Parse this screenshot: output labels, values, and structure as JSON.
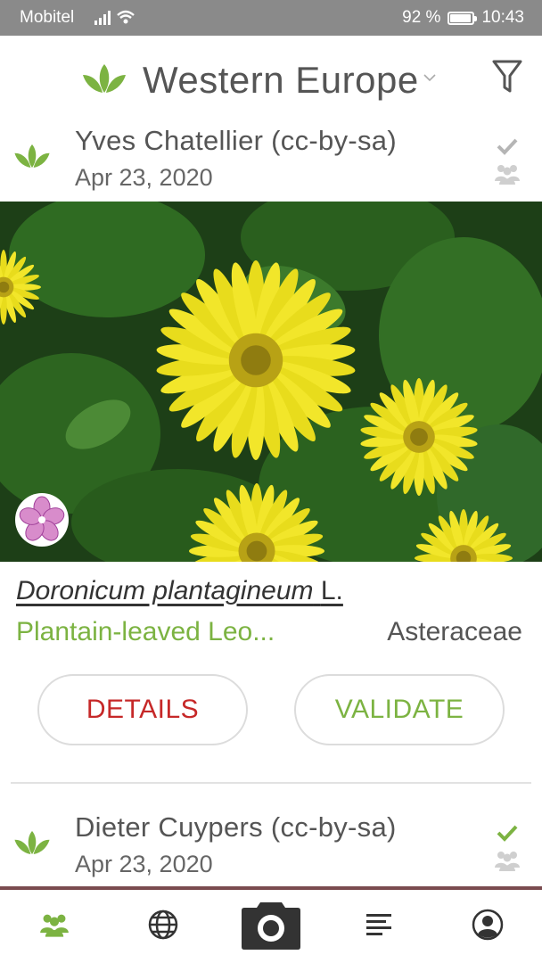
{
  "status_bar": {
    "carrier": "Mobitel",
    "battery": "92 %",
    "battery_level": 0.92,
    "time": "10:43"
  },
  "header": {
    "region": "Western Europe",
    "icons": [
      "leaf-logo-icon",
      "chevron-down-icon",
      "filter-icon"
    ]
  },
  "observations": [
    {
      "author": "Yves Chatellier (cc-by-sa)",
      "date": "Apr 23, 2020",
      "validated": false,
      "photo_subject": "yellow daisy flowers",
      "species": {
        "scientific": "Doronicum plantagineum",
        "authority": "L.",
        "common": "Plantain-leaved Leo...",
        "family": "Asteraceae"
      },
      "actions": {
        "details": "DETAILS",
        "validate": "VALIDATE"
      }
    },
    {
      "author": "Dieter Cuypers (cc-by-sa)",
      "date": "Apr 23, 2020",
      "validated": true
    }
  ],
  "nav": {
    "items": [
      "community-icon",
      "globe-icon",
      "camera-icon",
      "list-icon",
      "profile-icon"
    ],
    "active": "community-icon"
  },
  "colors": {
    "accent_green": "#7cb342",
    "details_red": "#c62828",
    "status_bar": "#8a8a8a"
  }
}
